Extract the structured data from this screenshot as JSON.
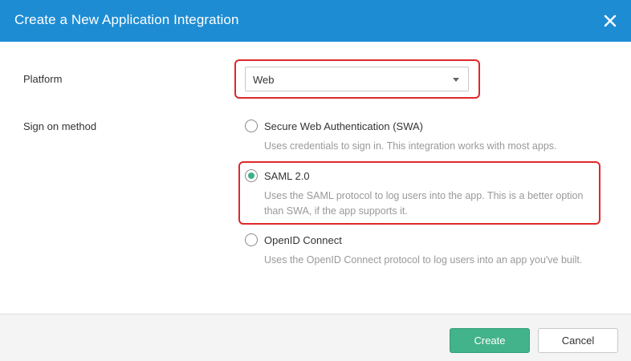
{
  "dialog": {
    "title": "Create a New Application Integration",
    "close_icon": "close-icon"
  },
  "platform": {
    "label": "Platform",
    "selected": "Web"
  },
  "sign_on": {
    "label": "Sign on method",
    "options": [
      {
        "title": "Secure Web Authentication (SWA)",
        "description": "Uses credentials to sign in. This integration works with most apps.",
        "checked": false
      },
      {
        "title": "SAML 2.0",
        "description_line1": "Uses the SAML protocol to log users into the app. This is a better option",
        "description_line2": "than SWA, if the app supports it.",
        "checked": true
      },
      {
        "title": "OpenID Connect",
        "description": "Uses the OpenID Connect protocol to log users into an app you've built.",
        "checked": false
      }
    ]
  },
  "footer": {
    "create_label": "Create",
    "cancel_label": "Cancel"
  },
  "colors": {
    "header": "#1d8cd3",
    "primary_button": "#42b38a",
    "radio_selected": "#3db087",
    "highlight": "#e02828"
  }
}
